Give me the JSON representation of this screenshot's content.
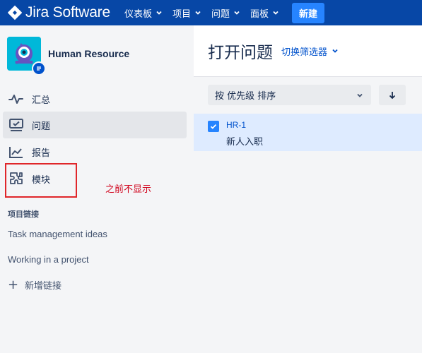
{
  "app": {
    "logo_text": "Jira Software",
    "brand_color": "#0747A6",
    "accent_color": "#2684FF"
  },
  "topnav": {
    "items": [
      {
        "label": "仪表板",
        "icon": "chevron-down-icon"
      },
      {
        "label": "项目",
        "icon": "chevron-down-icon"
      },
      {
        "label": "问题",
        "icon": "chevron-down-icon"
      },
      {
        "label": "面板",
        "icon": "chevron-down-icon"
      }
    ],
    "create_label": "新建"
  },
  "sidebar": {
    "project_name": "Human Resource",
    "project_avatar_icon": "project-avatar-icon",
    "items": [
      {
        "label": "汇总",
        "icon": "activity-icon"
      },
      {
        "label": "问题",
        "icon": "issues-icon",
        "active": true
      },
      {
        "label": "报告",
        "icon": "chart-icon"
      },
      {
        "label": "模块",
        "icon": "component-icon"
      }
    ],
    "links_title": "项目链接",
    "links": [
      {
        "label": "Task management ideas"
      },
      {
        "label": "Working in a project"
      }
    ],
    "add_link_label": "新增链接"
  },
  "annotation": {
    "text": "之前不显示",
    "color": "#D0021B"
  },
  "main": {
    "title": "打开问题",
    "switch_filter_label": "切换筛选器",
    "sort_label": "按 优先级 排序",
    "issues": [
      {
        "key": "HR-1",
        "summary": "新人入职",
        "selected": true
      }
    ]
  }
}
